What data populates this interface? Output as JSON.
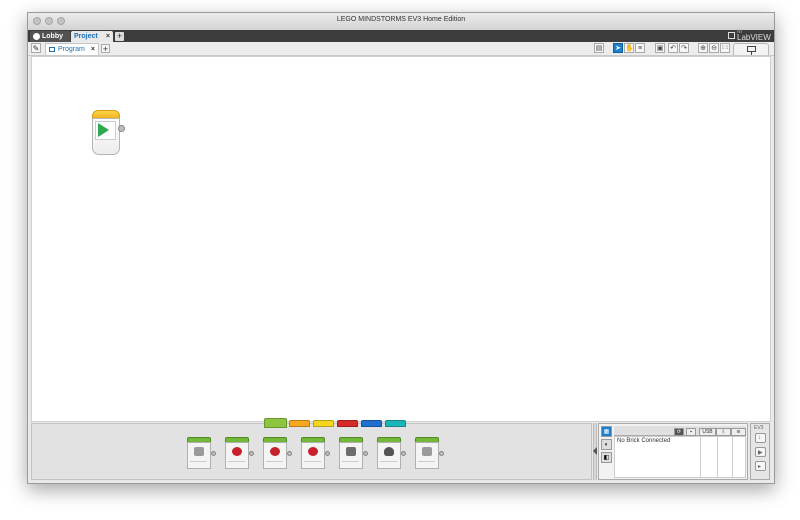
{
  "window": {
    "title": "LEGO MINDSTORMS EV3 Home Edition"
  },
  "project_tabs": [
    {
      "label": "Lobby",
      "icon": "home-icon"
    },
    {
      "label": "Project",
      "icon": "none",
      "close": "×"
    }
  ],
  "add_project": "+",
  "labview": {
    "ni_label": "NI",
    "label": "LabVIEW"
  },
  "program_tab": {
    "label": "Program",
    "close": "×",
    "add": "+"
  },
  "toolbar": {
    "icons": [
      "comment-icon",
      "select-arrow-icon",
      "pan-icon",
      "comment-tool-icon",
      "save-icon",
      "undo-icon",
      "redo-icon",
      "zoom-in-icon",
      "zoom-out-icon",
      "zoom-reset-icon"
    ],
    "zoom_reset_label": "1:1"
  },
  "canvas": {
    "start_block": "start-block"
  },
  "palette": {
    "tab_colors": [
      "#8cc63f",
      "#f7a821",
      "#f4d61c",
      "#d52a2a",
      "#1f6fd1",
      "#19b6b7"
    ],
    "blocks": [
      "medium-motor",
      "large-motor",
      "move-steering",
      "move-tank",
      "display",
      "sound",
      "brick-status-light"
    ]
  },
  "hardware_page": {
    "columns": [
      "USB",
      "Bluetooth",
      "WiFi"
    ],
    "usb_label": "USB",
    "status": "No Brick Connected"
  },
  "brick_panel": {
    "label": "EV3"
  }
}
